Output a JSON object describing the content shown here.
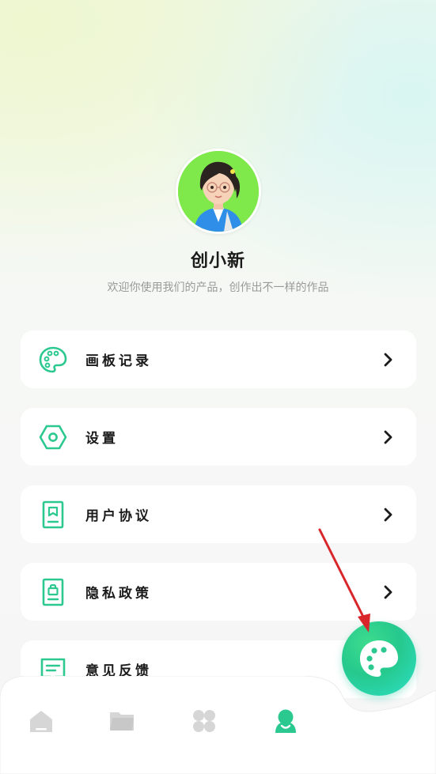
{
  "profile": {
    "name": "创小新",
    "slogan": "欢迎你使用我们的产品，创作出不一样的作品"
  },
  "menu": {
    "items": [
      {
        "label": "画板记录",
        "icon": "palette-icon"
      },
      {
        "label": "设置",
        "icon": "hexagon-settings-icon"
      },
      {
        "label": "用户协议",
        "icon": "document-bookmark-icon"
      },
      {
        "label": "隐私政策",
        "icon": "document-lock-icon"
      },
      {
        "label": "意见反馈",
        "icon": "message-feedback-icon"
      }
    ]
  },
  "tabbar": {
    "tabs": [
      {
        "icon": "home-icon",
        "active": false
      },
      {
        "icon": "folder-icon",
        "active": false
      },
      {
        "icon": "apps-grid-icon",
        "active": false
      },
      {
        "icon": "profile-icon",
        "active": true
      }
    ]
  },
  "fab": {
    "icon": "palette-icon"
  },
  "colors": {
    "accent": "#2bc98f",
    "inactive_icon": "#d6d6d6",
    "annotation_arrow": "#d9262b"
  }
}
